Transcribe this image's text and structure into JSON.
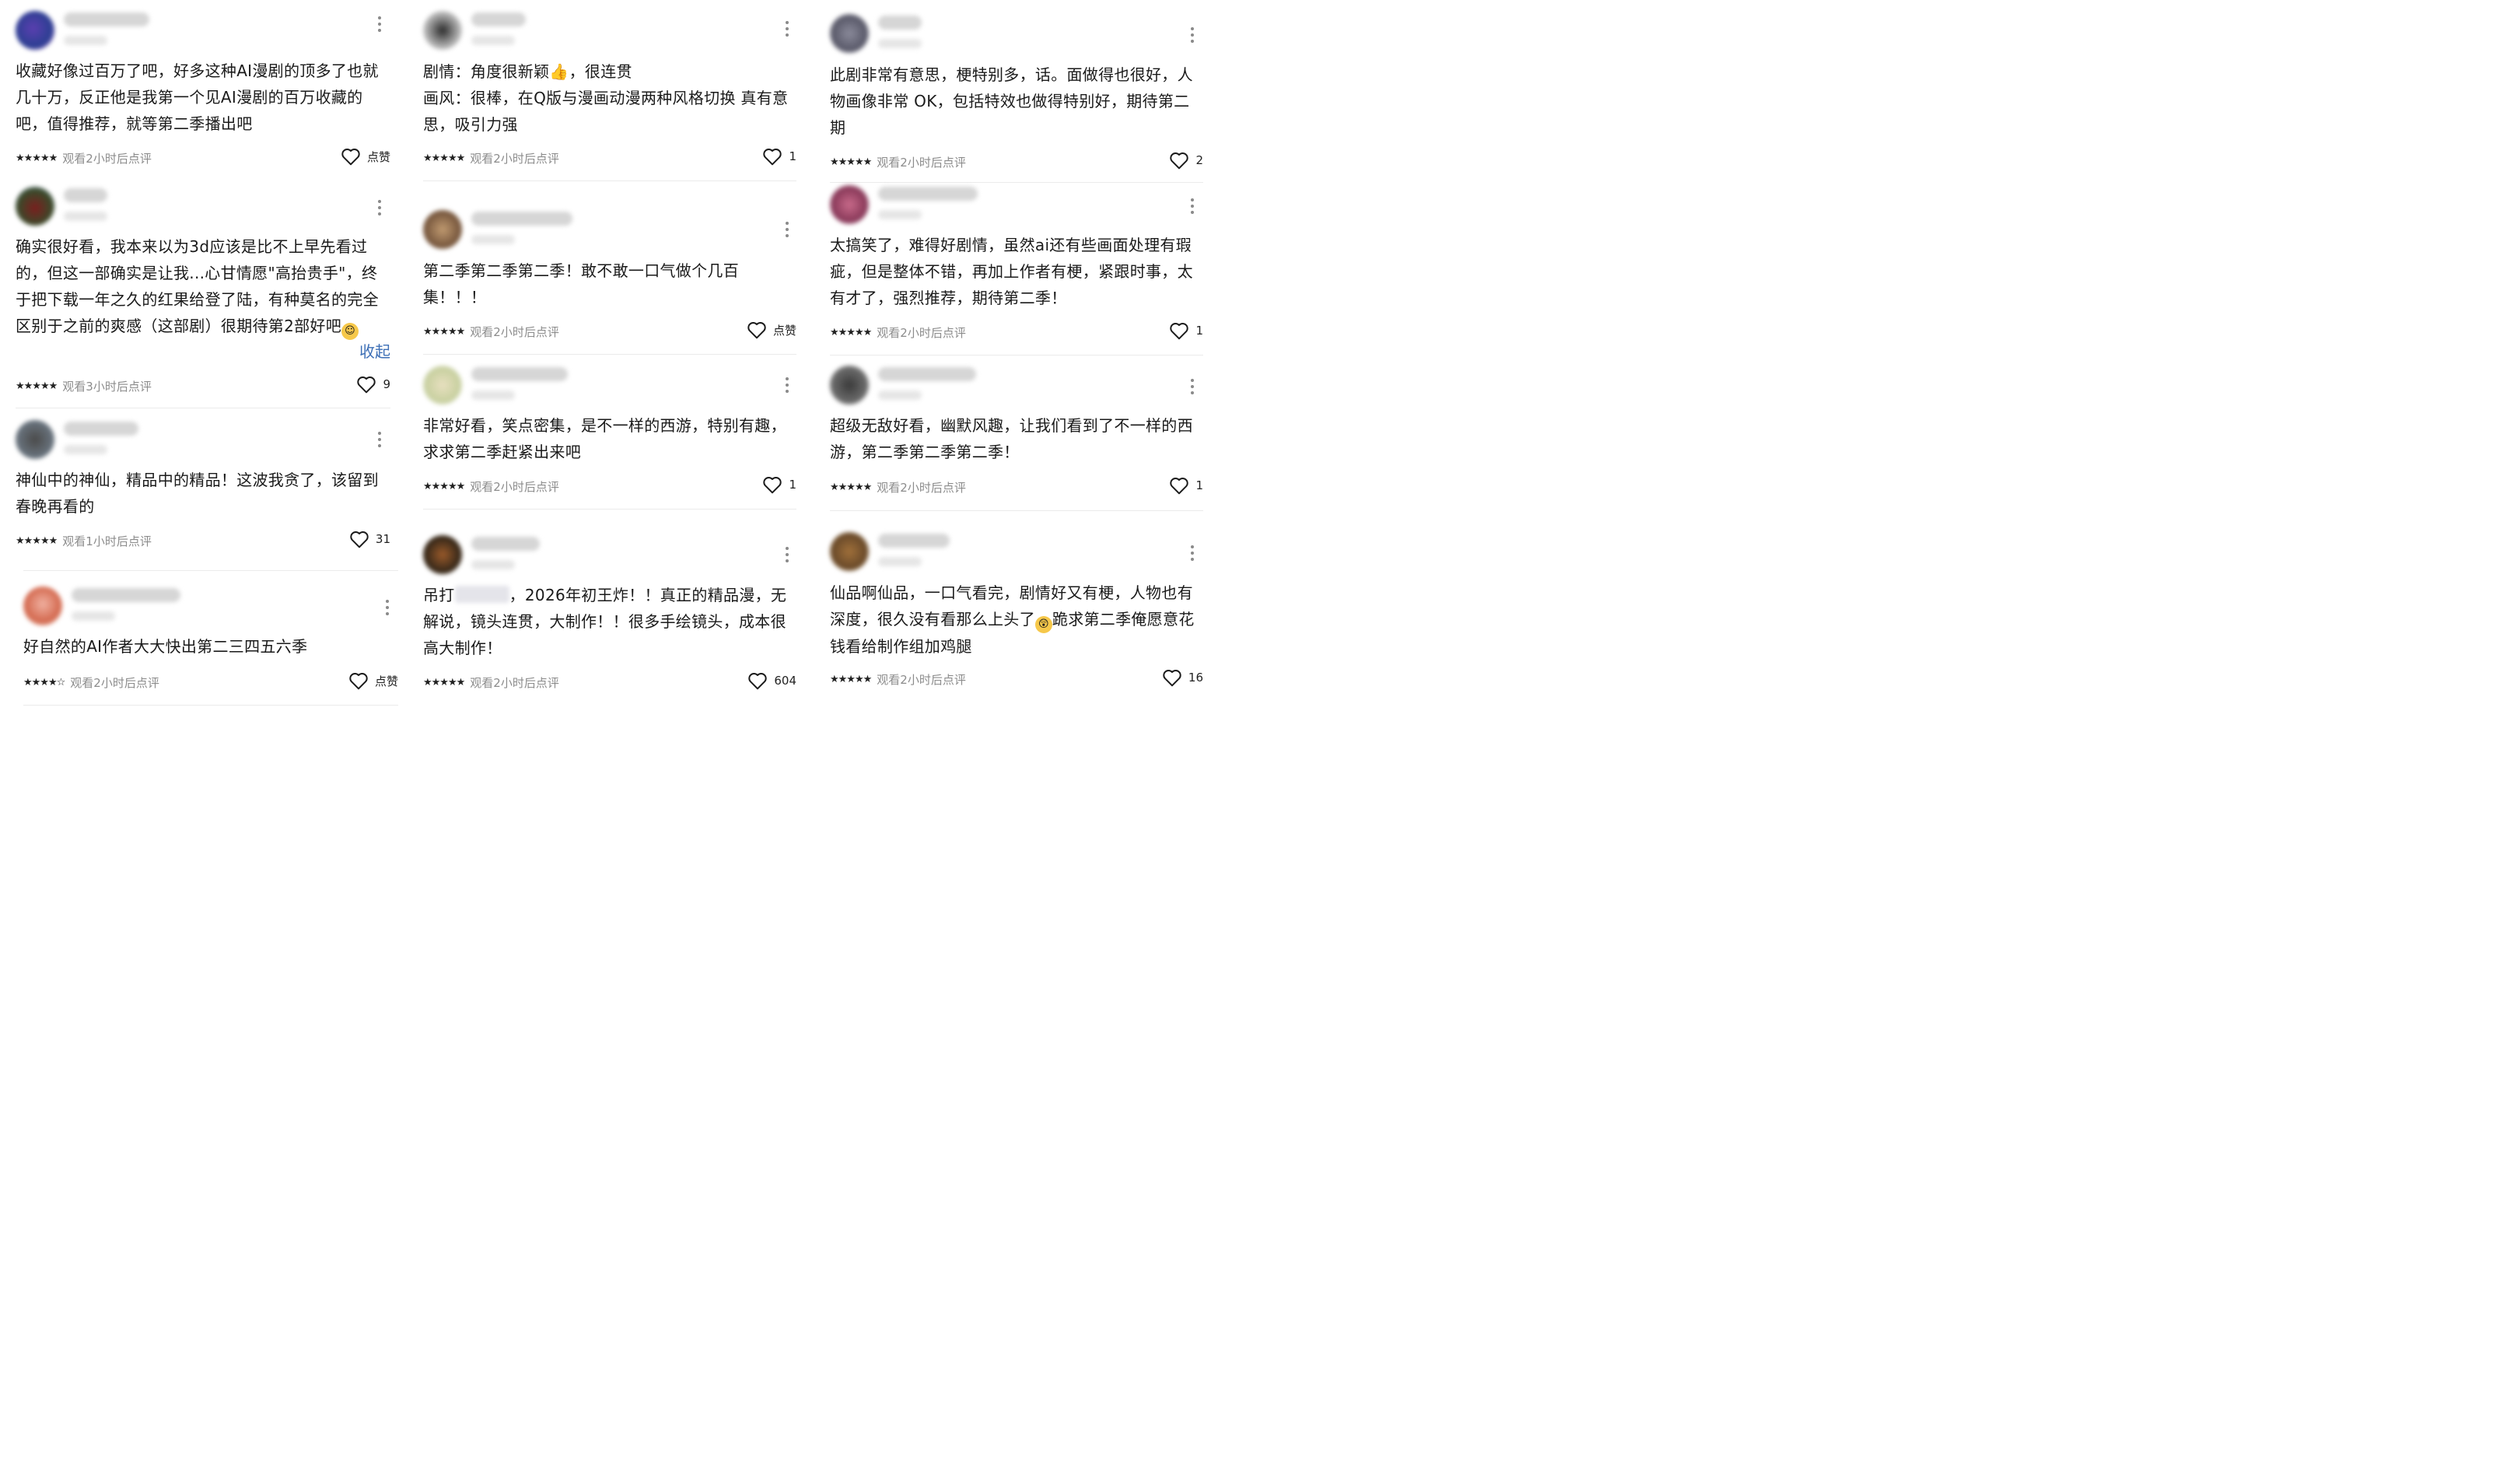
{
  "reviews": [
    {
      "text": "收藏好像过百万了吧，好多这种AI漫剧的顶多了也就几十万，反正他是我第一个见AI漫剧的百万收藏的吧，值得推荐，就等第二季播出吧",
      "stars": "★★★★★",
      "watch": "观看2小时后点评",
      "likes": "点赞"
    },
    {
      "text": "确实很好看，我本来以为3d应该是比不上早先看过的，但这一部确实是让我...心甘情愿\"高抬贵手\"，终于把下载一年之久的红果给登了陆，有种莫名的完全区别于之前的爽感（这部剧）很期待第2部好吧",
      "stars": "★★★★★",
      "watch": "观看3小时后点评",
      "likes": "9",
      "collapse": "收起"
    },
    {
      "text": "神仙中的神仙，精品中的精品！这波我贪了，该留到春晚再看的",
      "stars": "★★★★★",
      "watch": "观看1小时后点评",
      "likes": "31"
    },
    {
      "text": "好自然的AI作者大大快出第二三四五六季",
      "stars": "★★★★☆",
      "watch": "观看2小时后点评",
      "likes": "点赞"
    },
    {
      "text": "剧情：角度很新颖👍，很连贯\n画风：很棒，在Q版与漫画动漫两种风格切换 真有意思，吸引力强",
      "stars": "★★★★★",
      "watch": "观看2小时后点评",
      "likes": "1"
    },
    {
      "text": "第二季第二季第二季！敢不敢一口气做个几百集！！！",
      "stars": "★★★★★",
      "watch": "观看2小时后点评",
      "likes": "点赞"
    },
    {
      "text": "非常好看，笑点密集，是不一样的西游，特别有趣，求求第二季赶紧出来吧",
      "stars": "★★★★★",
      "watch": "观看2小时后点评",
      "likes": "1"
    },
    {
      "text_a": "吊打",
      "text_b": "，2026年初王炸！！真正的精品漫，无解说，镜头连贯，大制作！！很多手绘镜头，成本很高大制作！",
      "stars": "★★★★★",
      "watch": "观看2小时后点评",
      "likes": "604"
    },
    {
      "text": "此剧非常有意思，梗特别多，话。面做得也很好，人物画像非常 OK，包括特效也做得特别好，期待第二期",
      "stars": "★★★★★",
      "watch": "观看2小时后点评",
      "likes": "2"
    },
    {
      "text": "太搞笑了，难得好剧情，虽然ai还有些画面处理有瑕疵，但是整体不错，再加上作者有梗，紧跟时事，太有才了，强烈推荐，期待第二季！",
      "stars": "★★★★★",
      "watch": "观看2小时后点评",
      "likes": "1"
    },
    {
      "text": "超级无敌好看，幽默风趣，让我们看到了不一样的西游，第二季第二季第二季！",
      "stars": "★★★★★",
      "watch": "观看2小时后点评",
      "likes": "1"
    },
    {
      "text_a": "仙品啊仙品，一口气看完，剧情好又有梗，人物也有深度，很久没有看那么上头了",
      "text_b": "跪求第二季俺愿意花钱看给制作组加鸡腿",
      "stars": "★★★★★",
      "watch": "观看2小时后点评",
      "likes": "16"
    }
  ],
  "colors": {
    "accent": "#3d6fb6",
    "muted": "#8c8c8c"
  }
}
